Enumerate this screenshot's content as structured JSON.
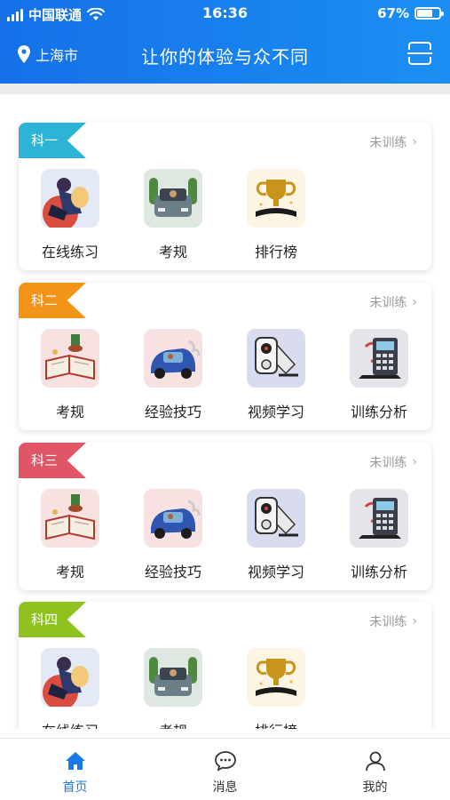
{
  "status_bar": {
    "carrier": "中国联通",
    "time": "16:36",
    "battery": "67%",
    "battery_level": 0.67
  },
  "header": {
    "city": "上海市",
    "title": "让你的体验与众不同"
  },
  "colors": {
    "header_blue": "#1777ea",
    "ke1": "#2db3d6",
    "ke2": "#f39419",
    "ke3": "#e05667",
    "ke4": "#8ec31f",
    "tab_active": "#1a78e8"
  },
  "sections": [
    {
      "tag": "科一",
      "status": "未训练",
      "items": [
        {
          "label": "在线练习",
          "icon": "reading-girl-icon"
        },
        {
          "label": "考规",
          "icon": "car-road-icon"
        },
        {
          "label": "排行榜",
          "icon": "trophy-icon"
        }
      ]
    },
    {
      "tag": "科二",
      "status": "未训练",
      "items": [
        {
          "label": "考规",
          "icon": "rulebook-icon"
        },
        {
          "label": "经验技巧",
          "icon": "car-driving-icon"
        },
        {
          "label": "视频学习",
          "icon": "camera-icon"
        },
        {
          "label": "训练分析",
          "icon": "calculator-icon"
        }
      ]
    },
    {
      "tag": "科三",
      "status": "未训练",
      "items": [
        {
          "label": "考规",
          "icon": "rulebook-icon"
        },
        {
          "label": "经验技巧",
          "icon": "car-driving-icon"
        },
        {
          "label": "视频学习",
          "icon": "camera-icon"
        },
        {
          "label": "训练分析",
          "icon": "calculator-icon"
        }
      ]
    },
    {
      "tag": "科四",
      "status": "未训练",
      "items": [
        {
          "label": "在线练习",
          "icon": "reading-girl-icon"
        },
        {
          "label": "考规",
          "icon": "car-road-icon"
        },
        {
          "label": "排行榜",
          "icon": "trophy-icon"
        }
      ]
    }
  ],
  "tabbar": {
    "tabs": [
      {
        "label": "首页",
        "icon": "home-icon"
      },
      {
        "label": "消息",
        "icon": "message-icon"
      },
      {
        "label": "我的",
        "icon": "user-icon"
      }
    ]
  }
}
